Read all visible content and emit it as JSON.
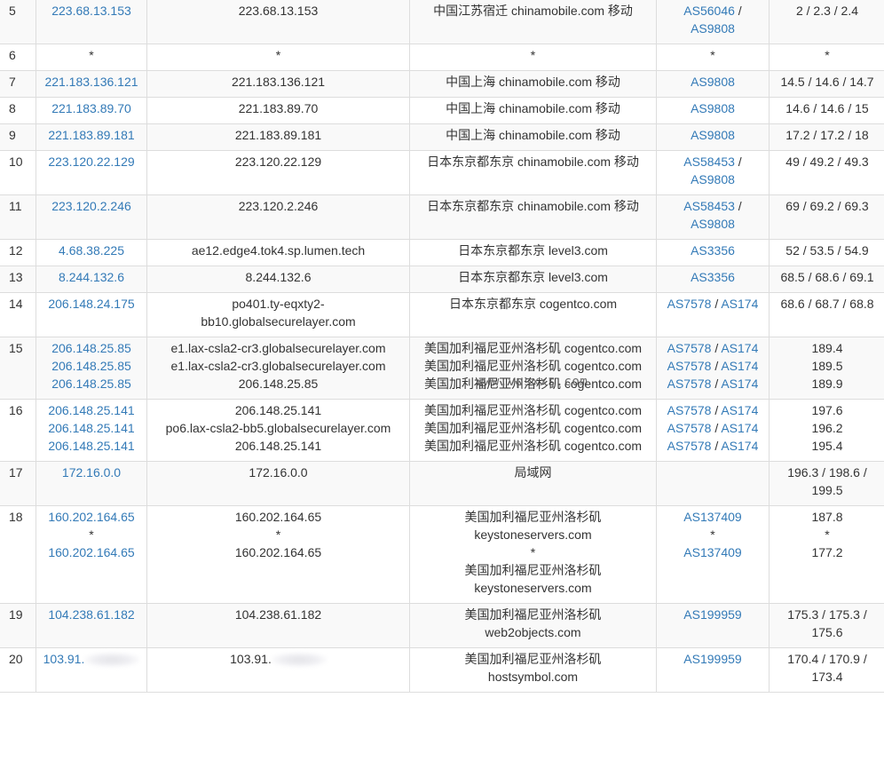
{
  "watermark": "www.vpsxxs.com",
  "rows": [
    {
      "hop": "5",
      "ip": [
        "223.68.13.153"
      ],
      "host": [
        "223.68.13.153"
      ],
      "loc": [
        "中国江苏宿迁 chinamobile.com 移动"
      ],
      "asn": [
        [
          "AS56046 /"
        ],
        [
          "AS9808"
        ]
      ],
      "lat": [
        "2 / 2.3 / 2.4"
      ]
    },
    {
      "hop": "6",
      "ip": [
        "*"
      ],
      "host": [
        "*"
      ],
      "loc": [
        "*"
      ],
      "asn": [
        [
          "*"
        ]
      ],
      "lat": [
        "*"
      ]
    },
    {
      "hop": "7",
      "ip": [
        "221.183.136.121"
      ],
      "host": [
        "221.183.136.121"
      ],
      "loc": [
        "中国上海 chinamobile.com 移动"
      ],
      "asn": [
        [
          "AS9808"
        ]
      ],
      "lat": [
        "14.5 / 14.6 / 14.7"
      ]
    },
    {
      "hop": "8",
      "ip": [
        "221.183.89.70"
      ],
      "host": [
        "221.183.89.70"
      ],
      "loc": [
        "中国上海 chinamobile.com 移动"
      ],
      "asn": [
        [
          "AS9808"
        ]
      ],
      "lat": [
        "14.6 / 14.6 / 15"
      ]
    },
    {
      "hop": "9",
      "ip": [
        "221.183.89.181"
      ],
      "host": [
        "221.183.89.181"
      ],
      "loc": [
        "中国上海 chinamobile.com 移动"
      ],
      "asn": [
        [
          "AS9808"
        ]
      ],
      "lat": [
        "17.2 / 17.2 / 18"
      ]
    },
    {
      "hop": "10",
      "ip": [
        "223.120.22.129"
      ],
      "host": [
        "223.120.22.129"
      ],
      "loc": [
        "日本东京都东京 chinamobile.com 移动"
      ],
      "asn": [
        [
          "AS58453 /"
        ],
        [
          "AS9808"
        ]
      ],
      "lat": [
        "49 / 49.2 / 49.3"
      ]
    },
    {
      "hop": "11",
      "ip": [
        "223.120.2.246"
      ],
      "host": [
        "223.120.2.246"
      ],
      "loc": [
        "日本东京都东京 chinamobile.com 移动"
      ],
      "asn": [
        [
          "AS58453 /"
        ],
        [
          "AS9808"
        ]
      ],
      "lat": [
        "69 / 69.2 / 69.3"
      ]
    },
    {
      "hop": "12",
      "ip": [
        "4.68.38.225"
      ],
      "host": [
        "ae12.edge4.tok4.sp.lumen.tech"
      ],
      "loc": [
        "日本东京都东京 level3.com"
      ],
      "asn": [
        [
          "AS3356"
        ]
      ],
      "lat": [
        "52 / 53.5 / 54.9"
      ]
    },
    {
      "hop": "13",
      "ip": [
        "8.244.132.6"
      ],
      "host": [
        "8.244.132.6"
      ],
      "loc": [
        "日本东京都东京 level3.com"
      ],
      "asn": [
        [
          "AS3356"
        ]
      ],
      "lat": [
        "68.5 / 68.6 / 69.1"
      ]
    },
    {
      "hop": "14",
      "ip": [
        "206.148.24.175"
      ],
      "host": [
        "po401.ty-eqxty2-",
        "bb10.globalsecurelayer.com"
      ],
      "loc": [
        "日本东京都东京 cogentco.com"
      ],
      "asn": [
        [
          "AS7578",
          "AS174"
        ]
      ],
      "lat": [
        "68.6 / 68.7 / 68.8"
      ]
    },
    {
      "hop": "15",
      "ip": [
        "206.148.25.85",
        "206.148.25.85",
        "206.148.25.85"
      ],
      "host": [
        "e1.lax-csla2-cr3.globalsecurelayer.com",
        "e1.lax-csla2-cr3.globalsecurelayer.com",
        "206.148.25.85"
      ],
      "loc": [
        "美国加利福尼亚州洛杉矶 cogentco.com",
        "美国加利福尼亚州洛杉矶 cogentco.com",
        "美国加利福尼亚州洛杉矶 cogentco.com"
      ],
      "asn": [
        [
          "AS7578",
          "AS174"
        ],
        [
          "AS7578",
          "AS174"
        ],
        [
          "AS7578",
          "AS174"
        ]
      ],
      "lat": [
        "189.4",
        "189.5",
        "189.9"
      ]
    },
    {
      "hop": "16",
      "ip": [
        "206.148.25.141",
        "206.148.25.141",
        "206.148.25.141"
      ],
      "host": [
        "206.148.25.141",
        "po6.lax-csla2-bb5.globalsecurelayer.com",
        "206.148.25.141"
      ],
      "loc": [
        "美国加利福尼亚州洛杉矶 cogentco.com",
        "美国加利福尼亚州洛杉矶 cogentco.com",
        "美国加利福尼亚州洛杉矶 cogentco.com"
      ],
      "asn": [
        [
          "AS7578",
          "AS174"
        ],
        [
          "AS7578",
          "AS174"
        ],
        [
          "AS7578",
          "AS174"
        ]
      ],
      "lat": [
        "197.6",
        "196.2",
        "195.4"
      ]
    },
    {
      "hop": "17",
      "ip": [
        "172.16.0.0"
      ],
      "host": [
        "172.16.0.0"
      ],
      "loc": [
        "局域网"
      ],
      "asn": [],
      "lat": [
        "196.3 / 198.6 /",
        "199.5"
      ]
    },
    {
      "hop": "18",
      "ip": [
        "160.202.164.65",
        "*",
        "160.202.164.65"
      ],
      "host": [
        "160.202.164.65",
        "*",
        "160.202.164.65"
      ],
      "loc": [
        "美国加利福尼亚州洛杉矶",
        "keystoneservers.com",
        "*",
        "美国加利福尼亚州洛杉矶",
        "keystoneservers.com"
      ],
      "asn": [
        [
          "AS137409"
        ],
        [
          "*"
        ],
        [
          "AS137409"
        ]
      ],
      "lat": [
        "187.8",
        "*",
        "177.2"
      ]
    },
    {
      "hop": "19",
      "ip": [
        "104.238.61.182"
      ],
      "host": [
        "104.238.61.182"
      ],
      "loc": [
        "美国加利福尼亚州洛杉矶",
        "web2objects.com"
      ],
      "asn": [
        [
          "AS199959"
        ]
      ],
      "lat": [
        "175.3 / 175.3 /",
        "175.6"
      ]
    },
    {
      "hop": "20",
      "ip": [
        "103.91."
      ],
      "host": [
        "103.91."
      ],
      "loc": [
        "美国加利福尼亚州洛杉矶",
        "hostsymbol.com"
      ],
      "asn": [
        [
          "AS199959"
        ]
      ],
      "lat": [
        "170.4 / 170.9 /",
        "173.4"
      ],
      "masked": true
    }
  ]
}
